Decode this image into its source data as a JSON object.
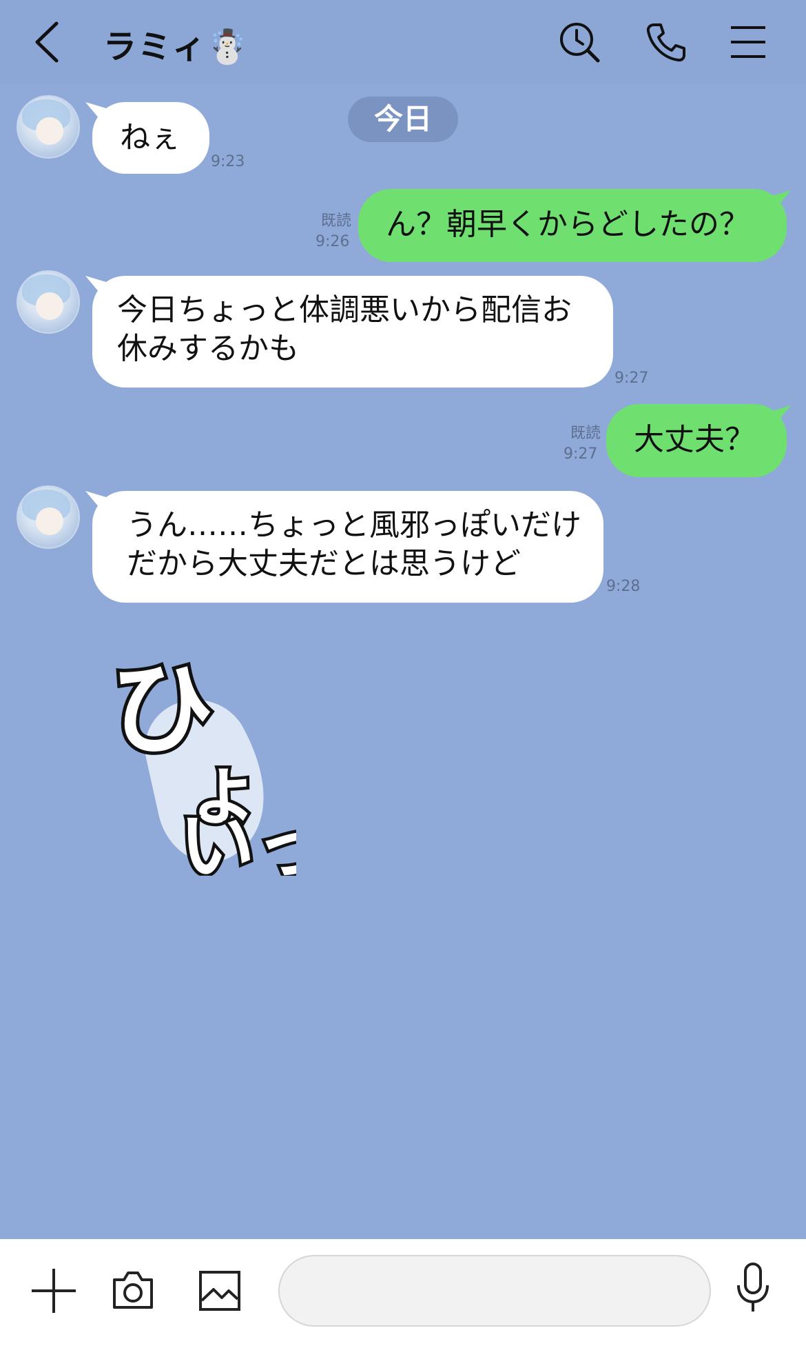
{
  "header": {
    "title": "ラミィ☃️",
    "icons": [
      "back-icon",
      "search-icon",
      "phone-icon",
      "menu-icon"
    ]
  },
  "date_label": "今日",
  "messages": [
    {
      "side": "in",
      "text": "ねぇ",
      "time": "9:23"
    },
    {
      "side": "out",
      "text": "ん？朝早くからどしたの？",
      "read": "既読",
      "time": "9:26"
    },
    {
      "side": "in",
      "text": "今日ちょっと体調悪いから配信お休みするかも",
      "time": "9:27"
    },
    {
      "side": "out",
      "text": "大丈夫？",
      "read": "既読",
      "time": "9:27"
    },
    {
      "side": "in",
      "text": "うん……ちょっと風邪っぽいだけだから大丈夫だとは思うけど",
      "time": "9:28"
    }
  ],
  "sticker": {
    "text": "ひょいっ"
  },
  "input": {
    "placeholder": ""
  },
  "bottom_icons": [
    "plus-icon",
    "camera-icon",
    "image-icon",
    "mic-icon"
  ],
  "colors": {
    "background": "#8faad8",
    "header": "#8ca6d5",
    "outgoing": "#6fe070",
    "incoming": "#ffffff",
    "date_pill": "#7b93c0"
  }
}
